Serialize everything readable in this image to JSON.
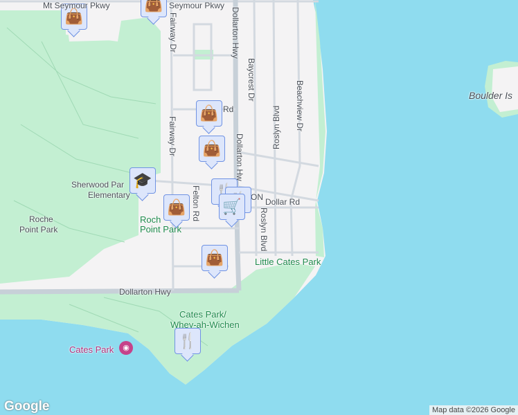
{
  "roads": {
    "mt_seymour_pkwy": "Mt Seymour Pkwy",
    "seymour_pkwy": "Seymour Pkwy",
    "dollarton_hwy_north": "Dollarton Hwy",
    "dollarton_hwy_mid": "Dollarton Hw",
    "dollarton_hwy_south": "Dollarton Hwy",
    "fairway_dr_1": "Fairway Dr",
    "fairway_dr_2": "Fairway Dr",
    "baycrest_dr": "Baycrest Dr",
    "beachview_dr": "Beachview Dr",
    "roslyn_blvd_1": "Roslyn Blvd",
    "roslyn_blvd_2": "Roslyn Blvd",
    "felton_rd": "Felton Rd",
    "dollar_rd": "Dollar Rd",
    "rd": "Rd",
    "on": "ON"
  },
  "places": {
    "sherwood_park_1": "Sherwood Par",
    "sherwood_park_2": "Elementary",
    "roche_point_park_1": "Roche",
    "roche_point_park_2": "Point Park",
    "roche_point_park_b1": "Roch",
    "roche_point_park_b2": "Point Park",
    "little_cates_park": "Little Cates Park",
    "cates_park_1": "Cates Park/",
    "cates_park_2": "Whey-ah-Wichen",
    "cates_park_poi": "Cates Park",
    "boulder_island": "Boulder Is"
  },
  "markers": [
    "shopping-bag",
    "shopping-bag",
    "shopping-bag",
    "shopping-bag",
    "shopping-bag",
    "shopping-bag",
    "school",
    "restaurant",
    "restaurant",
    "grocery-cart",
    "restaurant"
  ],
  "footer": {
    "logo": "Google",
    "attribution": "Map data ©2026 Google"
  },
  "colors": {
    "water": "#8fdcef",
    "land": "#f4f3f4",
    "park": "#c3efd2",
    "marker_bg": "#dde6fb",
    "marker_border": "#6f92e3",
    "icon": "#0d4a6b"
  }
}
